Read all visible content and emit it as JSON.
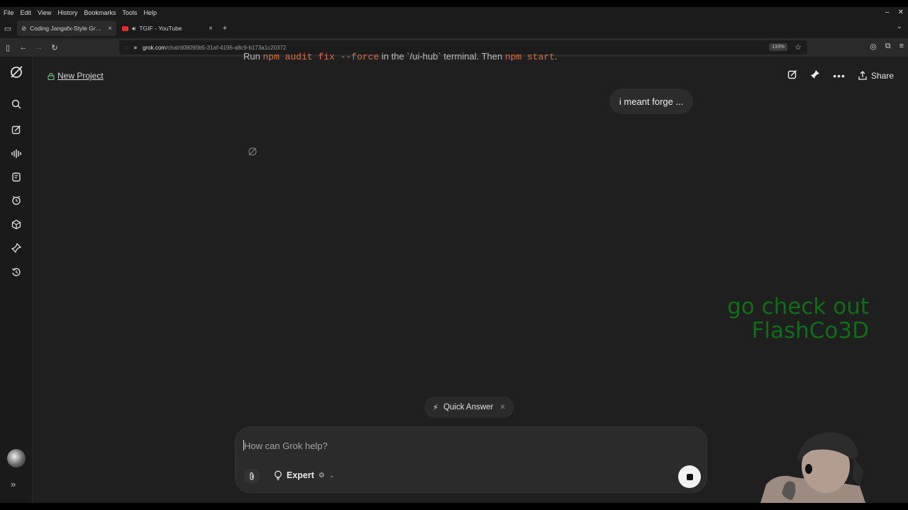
{
  "browser": {
    "menu": [
      "File",
      "Edit",
      "View",
      "History",
      "Bookmarks",
      "Tools",
      "Help"
    ],
    "tabs": [
      {
        "title": "Coding Jangafx-Style Graphi",
        "active": true
      },
      {
        "title": "TGIF - YouTube",
        "active": false
      }
    ],
    "url": {
      "host": "grok.com",
      "path": "/chat/d08090b5-31af-4196-a8c9-b173a1c20372"
    },
    "zoom": "133%"
  },
  "sidebar": {
    "icons": [
      "grok-logo-icon",
      "search-icon",
      "new-chat-icon",
      "voice-icon",
      "files-icon",
      "tasks-icon",
      "projects-icon",
      "pin-icon",
      "history-icon"
    ]
  },
  "header": {
    "new_project_label": "New Project",
    "share_label": "Share"
  },
  "chat": {
    "cutoff_text_pre": "Run ",
    "cutoff_code_1": "npm audit fix --force",
    "cutoff_text_mid": " in the `/ui-hub` terminal. Then ",
    "cutoff_code_2": "npm start",
    "cutoff_text_post": ".",
    "user_message": "i meant forge ..."
  },
  "composer": {
    "quick_answer_label": "Quick Answer",
    "placeholder": "How can Grok help?",
    "mode_label": "Expert"
  },
  "overlay": {
    "promo_line1": "go check out",
    "promo_line2": "FlashCo3D"
  },
  "colors": {
    "background": "#1f1f1f",
    "promo_green": "#0f6c19",
    "code_orange": "#d0734b"
  }
}
